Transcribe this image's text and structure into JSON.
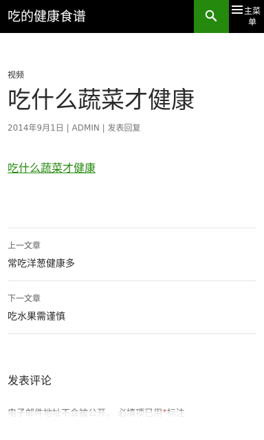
{
  "header": {
    "site_title": "吃的健康食谱",
    "search_icon": "search-icon",
    "menu_icon": "hamburger-menu-icon",
    "menu_label": "主菜单"
  },
  "post": {
    "category": "视频",
    "title": "吃什么蔬菜才健康",
    "meta": {
      "date": "2014年9月1日",
      "author": "ADMIN",
      "reply": "发表回复",
      "separator": "|"
    },
    "content_link": "吃什么蔬菜才健康"
  },
  "post_nav": {
    "prev_label": "上一文章",
    "prev_title": "常吃洋葱健康多",
    "next_label": "下一文章",
    "next_title": "吃水果需谨慎"
  },
  "comments": {
    "reply_title": "发表评论",
    "notes_before": "电子邮件地址不会被公开。 必填项已用",
    "required_mark": "*",
    "notes_after": "标注"
  },
  "colors": {
    "accent": "#24890d",
    "topbar": "#000000"
  }
}
